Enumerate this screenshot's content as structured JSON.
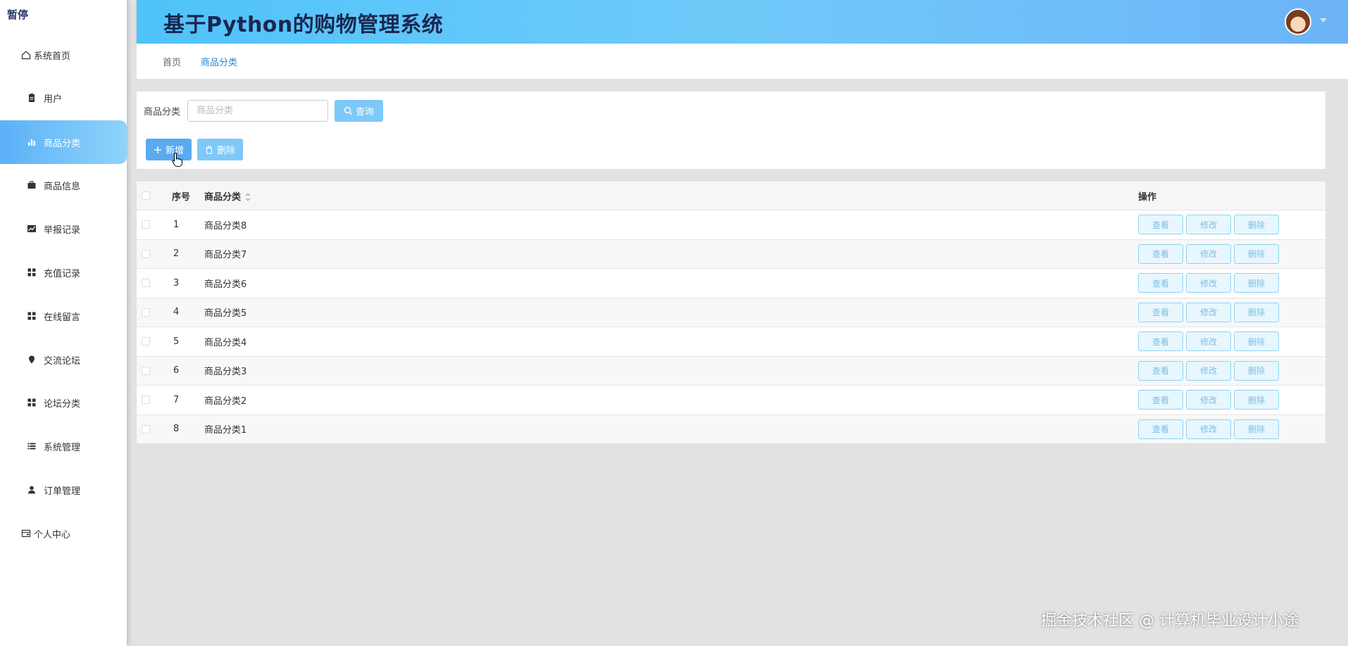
{
  "app": {
    "logo_text": "暂停",
    "title": "基于Python的购物管理系统"
  },
  "sidebar": {
    "items": [
      {
        "label": "系统首页",
        "icon": "home-icon"
      },
      {
        "label": "用户",
        "icon": "clipboard-icon"
      },
      {
        "label": "商品分类",
        "icon": "bar-chart-icon",
        "active": true
      },
      {
        "label": "商品信息",
        "icon": "briefcase-icon"
      },
      {
        "label": "举报记录",
        "icon": "line-chart-icon"
      },
      {
        "label": "充值记录",
        "icon": "grid-icon"
      },
      {
        "label": "在线留言",
        "icon": "grid-icon"
      },
      {
        "label": "交流论坛",
        "icon": "map-pin-icon"
      },
      {
        "label": "论坛分类",
        "icon": "grid-icon"
      },
      {
        "label": "系统管理",
        "icon": "list-icon"
      },
      {
        "label": "订单管理",
        "icon": "user-icon"
      },
      {
        "label": "个人中心",
        "icon": "id-card-icon"
      }
    ]
  },
  "breadcrumb": {
    "home": "首页",
    "current": "商品分类"
  },
  "search": {
    "label": "商品分类",
    "placeholder": "商品分类",
    "query_label": "查询"
  },
  "toolbar": {
    "add_label": "新增",
    "delete_label": "删除"
  },
  "table": {
    "headers": {
      "index": "序号",
      "name": "商品分类",
      "ops": "操作"
    },
    "rows": [
      {
        "index": "1",
        "name": "商品分类8"
      },
      {
        "index": "2",
        "name": "商品分类7"
      },
      {
        "index": "3",
        "name": "商品分类6"
      },
      {
        "index": "4",
        "name": "商品分类5"
      },
      {
        "index": "5",
        "name": "商品分类4"
      },
      {
        "index": "6",
        "name": "商品分类3"
      },
      {
        "index": "7",
        "name": "商品分类2"
      },
      {
        "index": "8",
        "name": "商品分类1"
      }
    ],
    "row_actions": {
      "view": "查看",
      "edit": "修改",
      "delete": "删除"
    }
  },
  "watermark": "掘金技术社区 @ 计算机毕业设计小途",
  "colors": {
    "header_gradient_start": "#4fc3fa",
    "header_gradient_end": "#6db3f7",
    "active_nav": "#5bb1f7",
    "primary_button": "#5aaaf1",
    "light_button": "#7ec8f7",
    "breadcrumb_active": "#2a84c9"
  }
}
